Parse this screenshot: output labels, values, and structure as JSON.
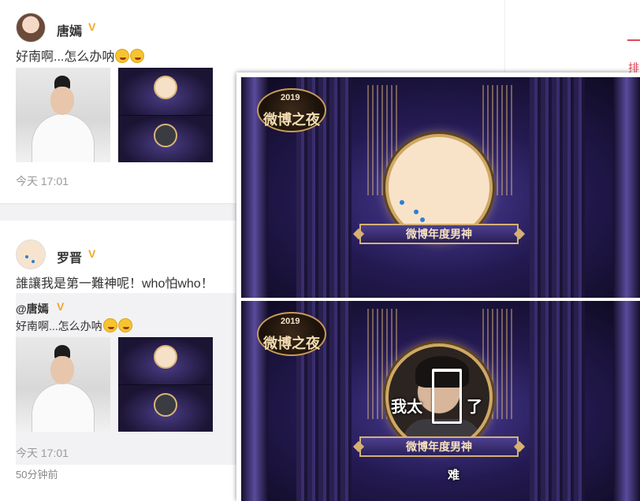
{
  "post1": {
    "username": "唐嫣",
    "verified_badge": "V",
    "text": "好南啊...怎么办呐",
    "time": "今天 17:01"
  },
  "post2": {
    "username": "罗晋",
    "verified_badge": "V",
    "text": "誰讓我是第一難神呢！who怕who！",
    "quote": {
      "username": "@唐嫣",
      "verified_badge": "V",
      "text": "好南啊...怎么办呐",
      "time": "今天 17:01"
    },
    "ago": "50分钟前"
  },
  "right_rail": {
    "partial_text": "排"
  },
  "overlay": {
    "top_panel": {
      "logo_year": "2019",
      "logo_text": "微博之夜",
      "banner": "微博年度男神"
    },
    "bottom_panel": {
      "logo_year": "2019",
      "logo_text": "微博之夜",
      "banner": "微博年度男神",
      "caption_left": "我太",
      "caption_right": "了",
      "caption_bottom": "难"
    }
  },
  "colors": {
    "accent": "#e0475a",
    "badge": "#f5a623",
    "gold": "#d6b173",
    "stage": "#241a52"
  }
}
